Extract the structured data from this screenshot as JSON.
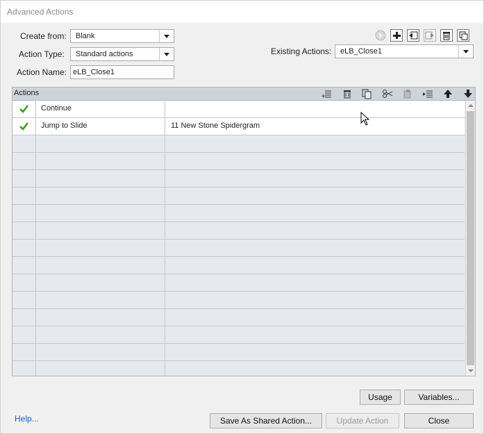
{
  "window": {
    "title": "Advanced Actions"
  },
  "form": {
    "create_from_label": "Create from:",
    "create_from_value": "Blank",
    "action_type_label": "Action Type:",
    "action_type_value": "Standard actions",
    "action_name_label": "Action Name:",
    "action_name_value": "eLB_Close1",
    "existing_actions_label": "Existing Actions:",
    "existing_actions_value": "eLB_Close1"
  },
  "top_toolbar": {
    "icons": [
      "preview-icon",
      "add-icon",
      "import-icon",
      "export-icon",
      "delete-icon",
      "duplicate-icon"
    ]
  },
  "table": {
    "header_title": "Actions",
    "header_icons": [
      "insert-row-icon",
      "delete-row-icon",
      "copy-icon",
      "cut-icon",
      "paste-icon",
      "indent-icon",
      "move-up-icon",
      "move-down-icon"
    ],
    "rows": [
      {
        "checked": true,
        "action": "Continue",
        "target": ""
      },
      {
        "checked": true,
        "action": "Jump to Slide",
        "target": "11 New Stone Spidergram"
      }
    ],
    "empty_row_count": 14
  },
  "buttons": {
    "usage": "Usage",
    "variables": "Variables...",
    "save_shared": "Save As Shared Action...",
    "update": "Update Action",
    "close": "Close"
  },
  "help_link": "Help..."
}
